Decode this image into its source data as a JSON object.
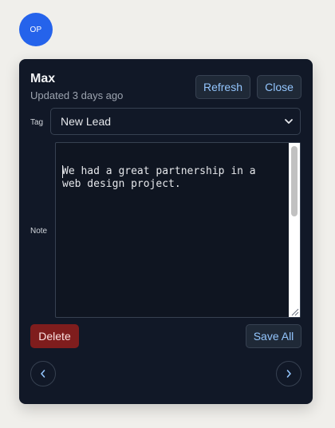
{
  "avatar": {
    "initials": "OP"
  },
  "contact": {
    "name": "Max",
    "updated": "Updated 3 days ago"
  },
  "header_buttons": {
    "refresh": "Refresh",
    "close": "Close"
  },
  "tag": {
    "label": "Tag",
    "selected": "New Lead"
  },
  "note": {
    "label": "Note",
    "value": "We had a great partnership in a\nweb design project."
  },
  "actions": {
    "delete": "Delete",
    "save_all": "Save All"
  },
  "nav": {
    "prev_icon": "chevron-left-icon",
    "next_icon": "chevron-right-icon"
  },
  "colors": {
    "avatar_bg": "#2563eb",
    "card_bg": "#111827",
    "accent_text": "#93c5fd",
    "delete_bg": "#7f1d1d"
  }
}
